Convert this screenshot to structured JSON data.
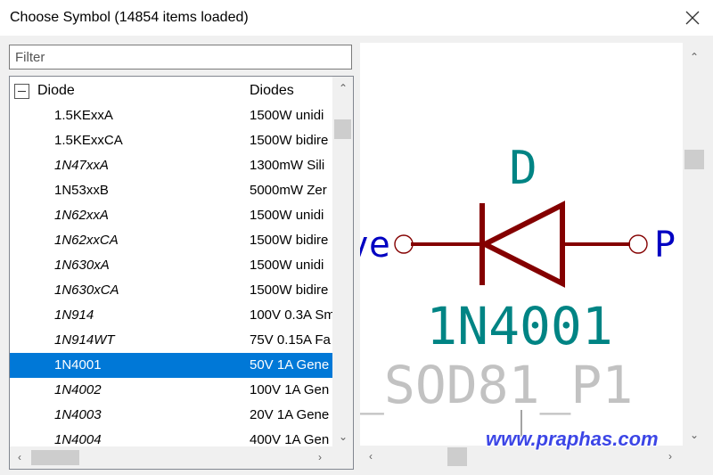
{
  "window": {
    "title": "Choose Symbol (14854 items loaded)"
  },
  "filter": {
    "placeholder": "Filter",
    "value": ""
  },
  "tree": {
    "group": {
      "name": "Diode",
      "description": "Diodes"
    },
    "items": [
      {
        "name": "1.5KExxA",
        "description": "1500W unidi",
        "italic": false
      },
      {
        "name": "1.5KExxCA",
        "description": "1500W bidire",
        "italic": false
      },
      {
        "name": "1N47xxA",
        "description": "1300mW Sili",
        "italic": true
      },
      {
        "name": "1N53xxB",
        "description": "5000mW Zer",
        "italic": false
      },
      {
        "name": "1N62xxA",
        "description": "1500W unidi",
        "italic": true
      },
      {
        "name": "1N62xxCA",
        "description": "1500W bidire",
        "italic": true
      },
      {
        "name": "1N630xA",
        "description": "1500W unidi",
        "italic": true
      },
      {
        "name": "1N630xCA",
        "description": "1500W bidire",
        "italic": true
      },
      {
        "name": "1N914",
        "description": "100V 0.3A Sm",
        "italic": true
      },
      {
        "name": "1N914WT",
        "description": "75V 0.15A Fa",
        "italic": true
      },
      {
        "name": "1N4001",
        "description": "50V 1A Gene",
        "italic": false,
        "selected": true
      },
      {
        "name": "1N4002",
        "description": "100V 1A Gen",
        "italic": true
      },
      {
        "name": "1N4003",
        "description": "20V 1A Gene",
        "italic": true
      },
      {
        "name": "1N4004",
        "description": "400V 1A Gen",
        "italic": true
      }
    ]
  },
  "preview": {
    "reference": "D",
    "value": "1N4001",
    "footprint": "_SOD81_P1",
    "pin_left": "ve",
    "pin_right": "P",
    "colors": {
      "body": "#840000",
      "field": "#008484",
      "pin": "#0000c2",
      "footprint": "#c2c2c2"
    }
  },
  "watermark": "www.praphas.com"
}
